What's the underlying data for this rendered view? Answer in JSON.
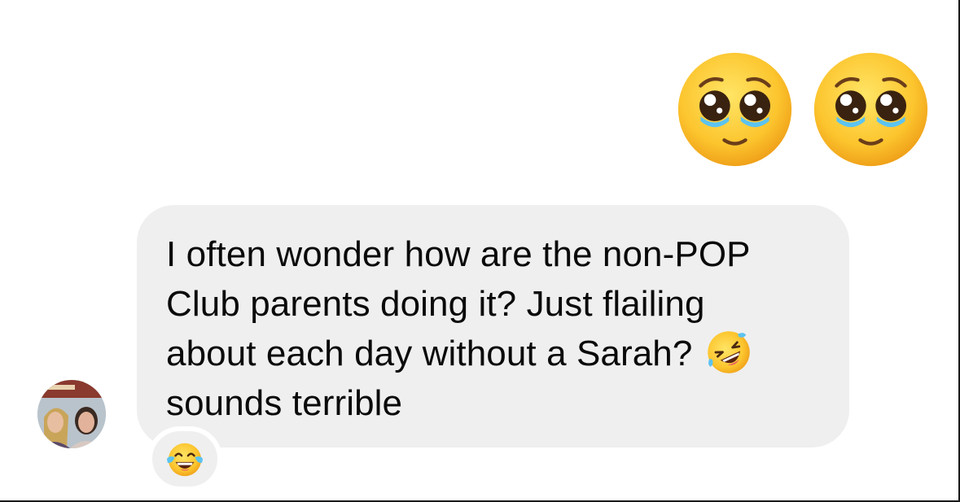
{
  "conversation": {
    "outgoing_message": {
      "content": "two pleading face emoji",
      "emoji": [
        "pleading-face",
        "pleading-face"
      ]
    },
    "incoming_message": {
      "lines": [
        "I often wonder how are the non-POP",
        "Club parents doing it? Just flailing",
        "about each day without a Sarah?",
        "sounds terrible"
      ],
      "inline_emoji": "rolling-on-floor-laughing",
      "reaction": "face-with-tears-of-joy",
      "sender_avatar": "profile photo"
    }
  },
  "colors": {
    "bubble": "#efefef",
    "text": "#0a0a0a",
    "background": "#ffffff"
  }
}
